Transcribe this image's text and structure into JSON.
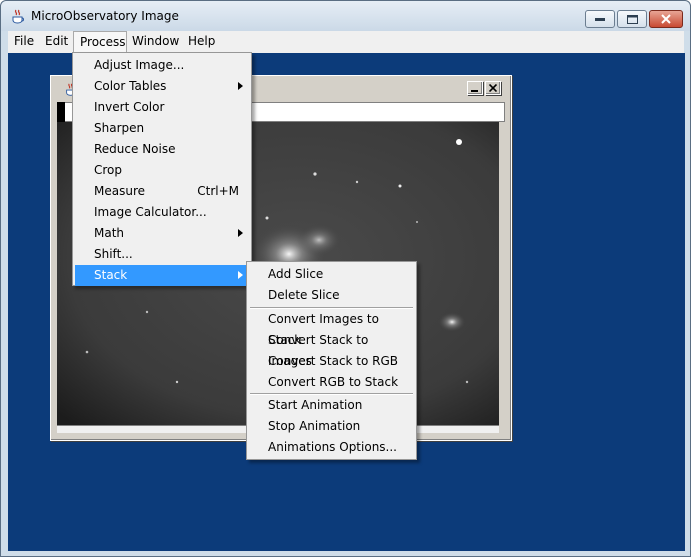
{
  "window": {
    "title": "MicroObservatory Image"
  },
  "menubar": {
    "items": [
      {
        "label": "File"
      },
      {
        "label": "Edit"
      },
      {
        "label": "Process"
      },
      {
        "label": "Window"
      },
      {
        "label": "Help"
      }
    ]
  },
  "process_menu": {
    "items": [
      {
        "label": "Adjust Image..."
      },
      {
        "label": "Color Tables",
        "submenu": true
      },
      {
        "label": "Invert Color"
      },
      {
        "label": "Sharpen"
      },
      {
        "label": "Reduce Noise"
      },
      {
        "label": "Crop"
      },
      {
        "label": "Measure",
        "shortcut": "Ctrl+M"
      },
      {
        "label": "Image Calculator..."
      },
      {
        "label": "Math",
        "submenu": true
      },
      {
        "label": "Shift..."
      },
      {
        "label": "Stack",
        "submenu": true,
        "highlighted": true
      }
    ]
  },
  "stack_menu": {
    "items": [
      {
        "label": "Add Slice"
      },
      {
        "label": "Delete Slice"
      },
      {
        "label": "Convert Images to Stack"
      },
      {
        "label": "Convert Stack to Images"
      },
      {
        "label": "Convert Stack to RGB"
      },
      {
        "label": "Convert RGB to Stack"
      },
      {
        "label": "Start Animation"
      },
      {
        "label": "Stop Animation"
      },
      {
        "label": "Animations Options..."
      }
    ]
  },
  "colors": {
    "desktop": "#0c3b7a",
    "menu_highlight": "#3399ff",
    "menu_bg": "#f0f0f0"
  },
  "icons": {
    "app": "java-cup-icon",
    "minimize": "minimize-icon",
    "maximize": "maximize-icon",
    "close": "close-icon"
  }
}
